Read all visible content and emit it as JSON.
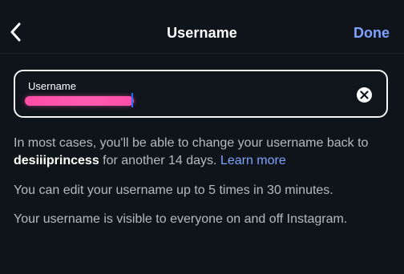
{
  "header": {
    "title": "Username",
    "done_label": "Done",
    "back_icon": "chevron-left-icon"
  },
  "field": {
    "label": "Username",
    "value_redacted": "",
    "clear_icon": "clear-x-icon"
  },
  "help": {
    "line1_prefix": "In most cases, you'll be able to change your username back to ",
    "previous_username": "desiiiprincess",
    "line1_suffix": " for another 14 days. ",
    "learn_more": "Learn more",
    "line2": "You can edit your username up to 5 times in 30 minutes.",
    "line3": "Your username is visible to everyone on and off Instagram."
  },
  "colors": {
    "background": "#0f141b",
    "accent": "#7fa2ff",
    "redaction": "#ff4da6"
  }
}
